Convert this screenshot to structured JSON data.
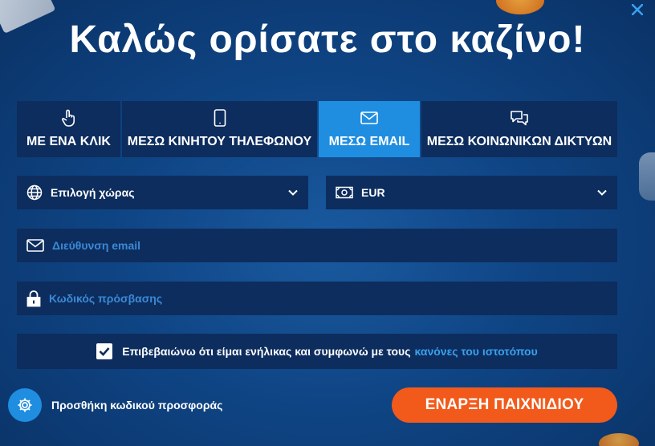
{
  "title": "Καλώς ορίσατε στο καζίνο!",
  "tabs": [
    {
      "label": "ΜΕ ΕΝΑ ΚΛΙΚ",
      "icon": "hand-pointer-icon",
      "active": false
    },
    {
      "label": "ΜΕΣΩ ΚΙΝΗΤΟΥ ΤΗΛΕΦΩΝΟΥ",
      "icon": "mobile-phone-icon",
      "active": false
    },
    {
      "label": "ΜΕΣΩ EMAIL",
      "icon": "envelope-icon",
      "active": true
    },
    {
      "label": "ΜΕΣΩ ΚΟΙΝΩΝΙΚΩΝ ΔΙΚΤΥΩΝ",
      "icon": "chat-bubbles-icon",
      "active": false
    }
  ],
  "form": {
    "country": {
      "value": "Επιλογή χώρας",
      "icon": "globe-icon"
    },
    "currency": {
      "value": "EUR",
      "icon": "banknote-icon"
    },
    "email": {
      "placeholder": "Διεύθυνση email",
      "icon": "envelope-icon"
    },
    "password": {
      "placeholder": "Κωδικός πρόσβασης",
      "icon": "lock-icon"
    }
  },
  "consent": {
    "text": "Επιβεβαιώνω ότι είμαι ενήλικας και συμφωνώ με τους",
    "link": "κανόνες του ιστοτόπου",
    "checked": true
  },
  "promo": {
    "label": "Προσθήκη κωδικού προσφοράς",
    "icon": "gear-icon"
  },
  "start_button": "ΕΝΑΡΞΗ ΠΑΙΧΝΙΔΙΟΥ",
  "colors": {
    "background": "#0f4585",
    "panel": "#0d2d5e",
    "accent": "#1f8ee0",
    "cta": "#f15a1a",
    "link": "#3aa0ee"
  }
}
